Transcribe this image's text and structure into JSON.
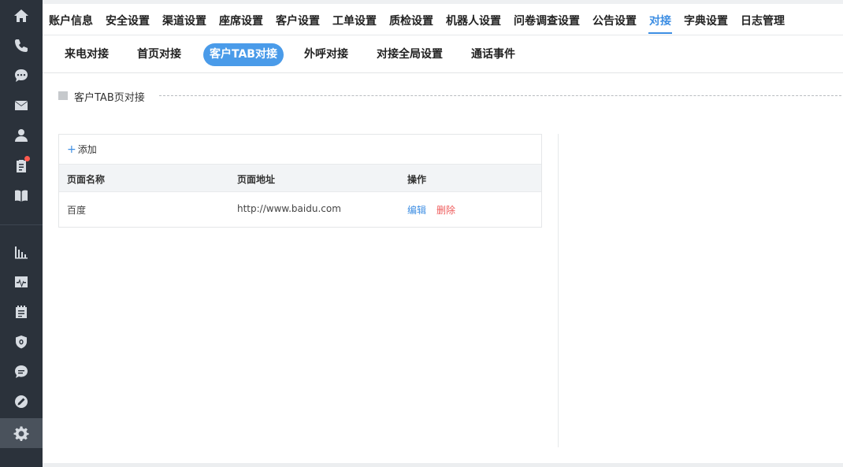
{
  "top_nav": {
    "items": [
      {
        "label": "账户信息"
      },
      {
        "label": "安全设置"
      },
      {
        "label": "渠道设置"
      },
      {
        "label": "座席设置"
      },
      {
        "label": "客户设置"
      },
      {
        "label": "工单设置"
      },
      {
        "label": "质检设置"
      },
      {
        "label": "机器人设置"
      },
      {
        "label": "问卷调查设置"
      },
      {
        "label": "公告设置"
      },
      {
        "label": "对接",
        "active": true
      },
      {
        "label": "字典设置"
      },
      {
        "label": "日志管理"
      }
    ],
    "accent_color": "#3d8ee3"
  },
  "sub_tabs": {
    "items": [
      {
        "label": "来电对接"
      },
      {
        "label": "首页对接"
      },
      {
        "label": "客户TAB对接",
        "active": true
      },
      {
        "label": "外呼对接"
      },
      {
        "label": "对接全局设置"
      },
      {
        "label": "通话事件"
      }
    ]
  },
  "section": {
    "title": "客户TAB页对接"
  },
  "table": {
    "add_label": "添加",
    "columns": [
      "页面名称",
      "页面地址",
      "操作"
    ],
    "rows": [
      {
        "name": "百度",
        "url": "http://www.baidu.com",
        "edit_label": "编辑",
        "delete_label": "删除"
      }
    ]
  },
  "sidebar": {
    "icons": [
      "home-icon",
      "phone-icon",
      "chat-icon",
      "mail-icon",
      "user-icon",
      "clipboard-icon",
      "book-icon",
      "bar-chart-icon",
      "monitor-icon",
      "notepad-icon",
      "shield-icon",
      "message-icon",
      "link-icon",
      "gear-icon"
    ],
    "active_icon": "gear-icon",
    "notification_color": "#ff5a4f"
  }
}
